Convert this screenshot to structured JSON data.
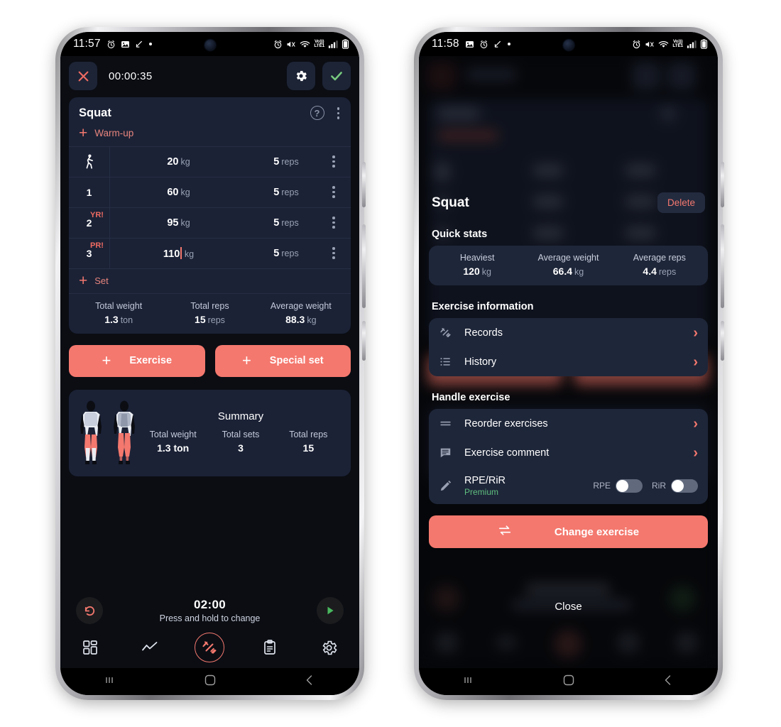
{
  "phone1": {
    "statusbar": {
      "time": "11:57",
      "left_icons": [
        "alarm-clock-icon",
        "image-icon",
        "download-icon",
        "dot-icon"
      ],
      "right_icons": [
        "alarm-icon",
        "mute-icon",
        "wifi-icon",
        "volte-icon",
        "signal-icon",
        "battery-icon"
      ],
      "network_label_top": "Vo)))",
      "network_label_bottom": "LTE1"
    },
    "topbar": {
      "close_label": "×",
      "timer": "00:00:35",
      "settings_label": "settings",
      "confirm_label": "confirm"
    },
    "exercise": {
      "name": "Squat",
      "help_label": "?",
      "warmup_label": "Warm-up",
      "add_set_label": "Set",
      "sets": [
        {
          "index": "",
          "icon": "warmup-person-icon",
          "badge": "",
          "weight": "20",
          "weight_unit": "kg",
          "reps": "5",
          "reps_unit": "reps",
          "editing": false
        },
        {
          "index": "1",
          "icon": "",
          "badge": "",
          "weight": "60",
          "weight_unit": "kg",
          "reps": "5",
          "reps_unit": "reps",
          "editing": false
        },
        {
          "index": "2",
          "icon": "",
          "badge": "YR!",
          "weight": "95",
          "weight_unit": "kg",
          "reps": "5",
          "reps_unit": "reps",
          "editing": false
        },
        {
          "index": "3",
          "icon": "",
          "badge": "PR!",
          "weight": "110",
          "weight_unit": "kg",
          "reps": "5",
          "reps_unit": "reps",
          "editing": true
        }
      ],
      "totals": [
        {
          "label": "Total weight",
          "value": "1.3",
          "unit": "ton"
        },
        {
          "label": "Total reps",
          "value": "15",
          "unit": "reps"
        },
        {
          "label": "Average weight",
          "value": "88.3",
          "unit": "kg"
        }
      ]
    },
    "actions": {
      "exercise_label": "Exercise",
      "special_set_label": "Special set",
      "plus": "+"
    },
    "summary": {
      "title": "Summary",
      "stats": [
        {
          "label": "Total weight",
          "value": "1.3 ton"
        },
        {
          "label": "Total sets",
          "value": "3"
        },
        {
          "label": "Total reps",
          "value": "15"
        }
      ]
    },
    "rest": {
      "reset_icon": "rotate-left-icon",
      "time": "02:00",
      "hint": "Press and hold to change",
      "play_icon": "play-icon"
    },
    "tabs": [
      {
        "name": "dashboard-icon",
        "active": false
      },
      {
        "name": "chart-icon",
        "active": false
      },
      {
        "name": "dumbbell-icon",
        "active": true
      },
      {
        "name": "clipboard-icon",
        "active": false
      },
      {
        "name": "gear-icon",
        "active": false
      }
    ],
    "navbar": [
      "recents-icon",
      "home-icon",
      "back-icon"
    ]
  },
  "phone2": {
    "statusbar": {
      "time": "11:58",
      "network_label_top": "Vo)))",
      "network_label_bottom": "LTE1"
    },
    "sheet": {
      "title": "Squat",
      "delete_label": "Delete",
      "quick_stats_label": "Quick stats",
      "quick_stats": [
        {
          "label": "Heaviest",
          "value": "120",
          "unit": "kg"
        },
        {
          "label": "Average weight",
          "value": "66.4",
          "unit": "kg"
        },
        {
          "label": "Average reps",
          "value": "4.4",
          "unit": "reps"
        }
      ],
      "exercise_info_label": "Exercise information",
      "exercise_info_rows": [
        {
          "icon": "dumbbell-icon",
          "label": "Records"
        },
        {
          "icon": "list-icon",
          "label": "History"
        }
      ],
      "handle_exercise_label": "Handle exercise",
      "handle_rows": [
        {
          "icon": "reorder-icon",
          "label": "Reorder exercises",
          "type": "chevron"
        },
        {
          "icon": "comment-icon",
          "label": "Exercise comment",
          "type": "chevron"
        },
        {
          "icon": "pencil-icon",
          "label": "RPE/RiR",
          "sub": "Premium",
          "type": "toggles",
          "toggles": [
            {
              "label": "RPE",
              "on": false
            },
            {
              "label": "RiR",
              "on": false
            }
          ]
        }
      ],
      "change_exercise_label": "Change exercise",
      "change_exercise_icon": "swap-icon",
      "close_label": "Close"
    },
    "navbar": [
      "recents-icon",
      "home-icon",
      "back-icon"
    ]
  },
  "colors": {
    "accent": "#f4786e",
    "card": "#1b2236",
    "card_alt": "#1e2639",
    "app_bg": "#0b0d13",
    "divider": "#262e44",
    "muted_text": "#9aa3b6",
    "premium_green": "#5fbf7f",
    "confirm_green": "#77c97f",
    "close_red": "#ef6b62"
  }
}
